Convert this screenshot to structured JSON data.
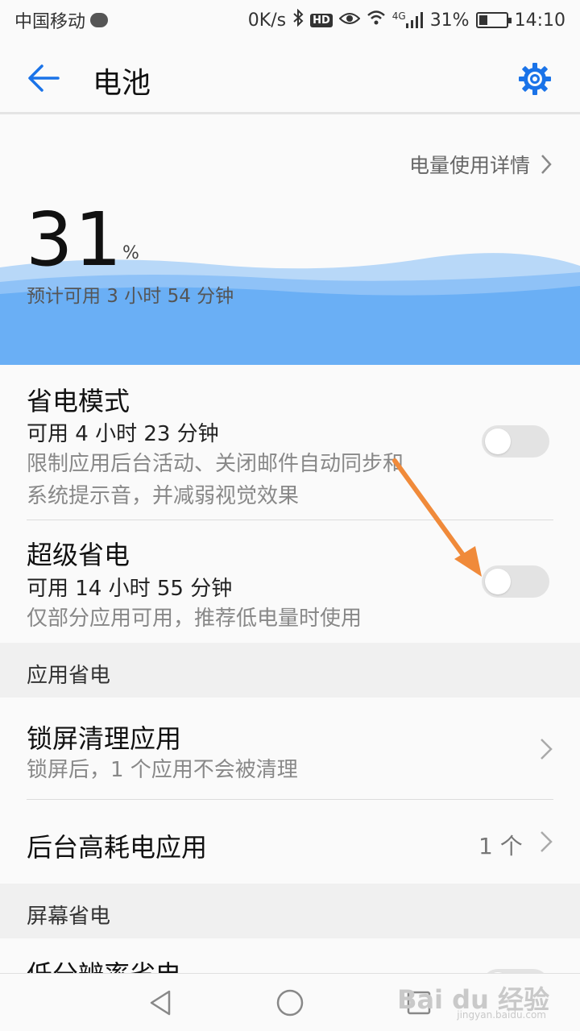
{
  "status_bar": {
    "carrier": "中国移动",
    "net_speed": "0K/s",
    "hd": "HD",
    "signal_label": "4G",
    "battery_pct": "31%",
    "time": "14:10"
  },
  "app_bar": {
    "title": "电池"
  },
  "usage_detail_link": "电量使用详情",
  "battery": {
    "percent": "31",
    "percent_sign": "%",
    "estimate": "预计可用 3 小时 54 分钟"
  },
  "power_saving": {
    "title": "省电模式",
    "available": "可用 4 小时 23 分钟",
    "description_line1": "限制应用后台活动、关闭邮件自动同步和",
    "description_line2": "系统提示音，并减弱视觉效果",
    "enabled": false
  },
  "ultra_power_saving": {
    "title": "超级省电",
    "available": "可用 14 小时 55 分钟",
    "description": "仅部分应用可用，推荐低电量时使用",
    "enabled": false
  },
  "app_saving_section": {
    "header": "应用省电",
    "items": [
      {
        "title": "锁屏清理应用",
        "subtitle": "锁屏后，1 个应用不会被清理"
      },
      {
        "title": "后台高耗电应用",
        "count": "1 个"
      }
    ]
  },
  "screen_saving_section": {
    "header": "屏幕省电",
    "items": [
      {
        "title": "低分辨率省电"
      }
    ]
  },
  "watermark": {
    "brand": "Bai du 经验",
    "url": "jingyan.baidu.com"
  },
  "colors": {
    "accent": "#1a73e8",
    "wave_dark": "#6aaff5",
    "wave_light": "#b8d8f8",
    "annotation_arrow": "#f08a3a"
  }
}
